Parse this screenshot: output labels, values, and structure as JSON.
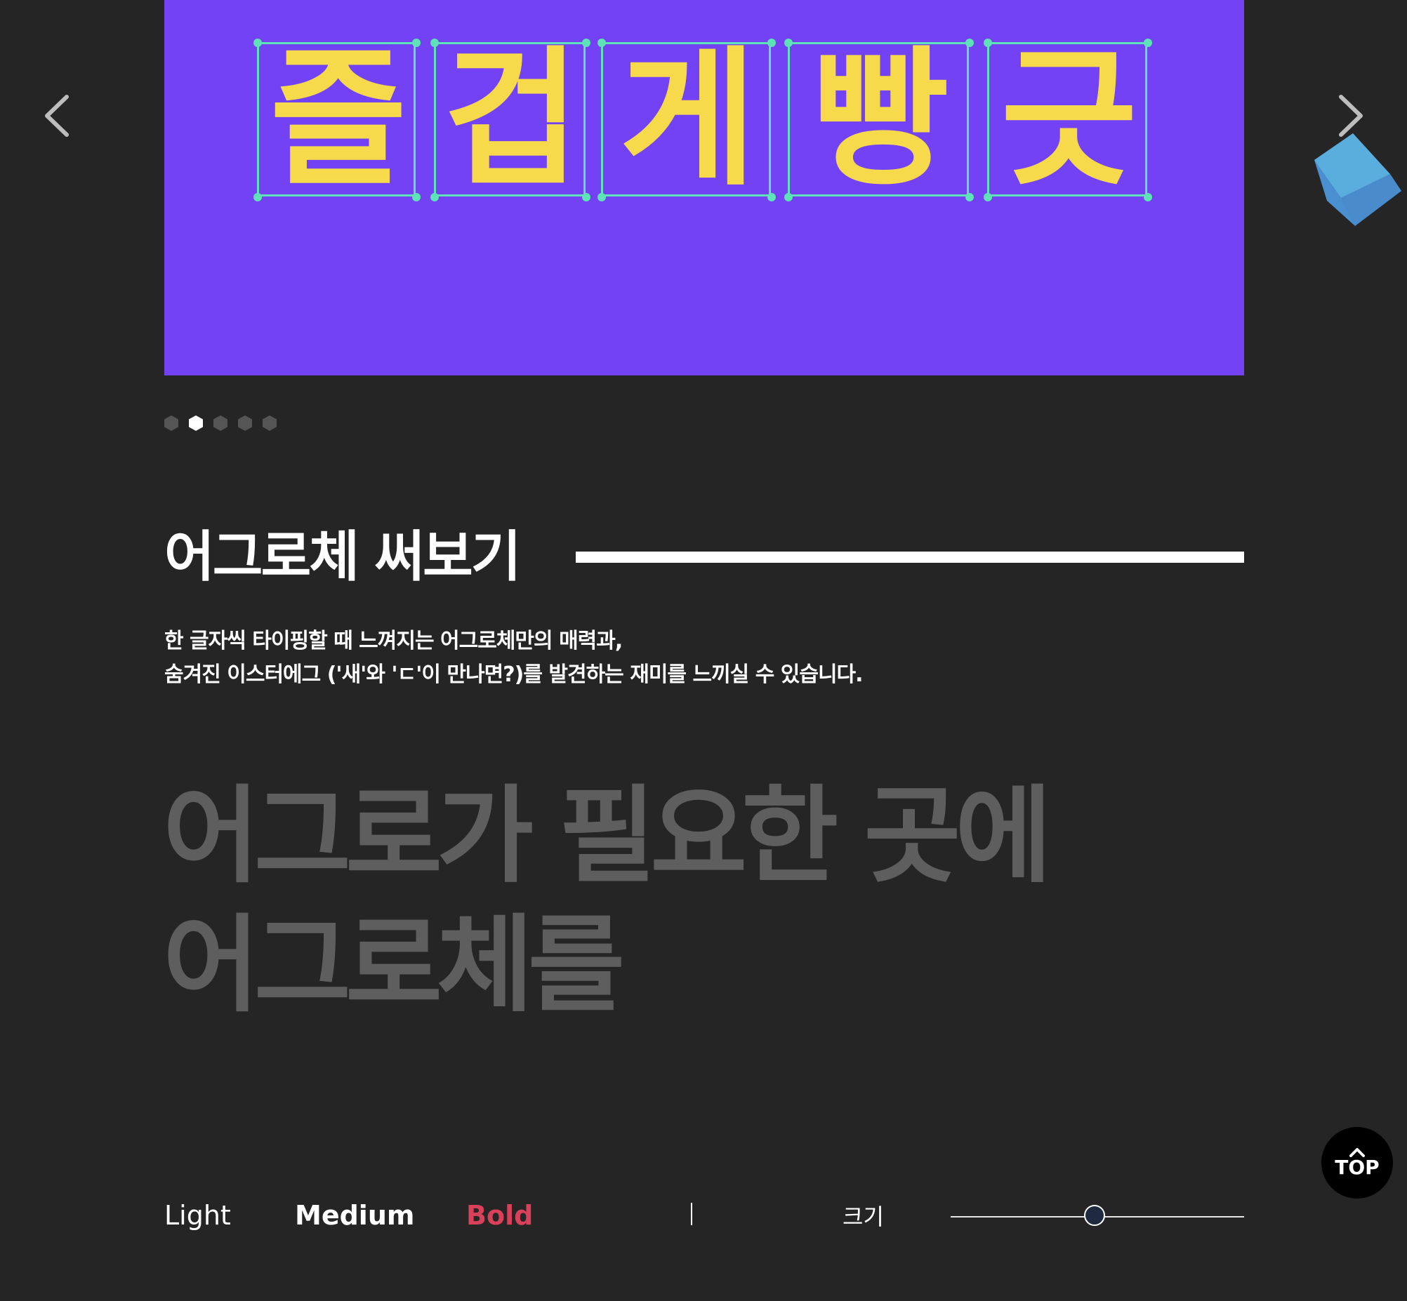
{
  "carousel": {
    "banner_glyphs": [
      "즐",
      "겁",
      "게",
      "빵",
      "긋"
    ],
    "prev_icon": "chevron-left-icon",
    "next_icon": "chevron-right-icon",
    "slide_count": 5,
    "active_slide": 2,
    "banner_color": "#7242f4",
    "glyph_color": "#f7d94c",
    "guide_color": "#5ee2b8"
  },
  "decor": {
    "cube_icon": "cube-icon",
    "cube_color": "#4a90d0"
  },
  "section": {
    "title": "어그로체 써보기",
    "description": [
      "한 글자씩 타이핑할 때 느껴지는 어그로체만의 매력과,",
      "숨겨진 이스터에그 ('새'와 'ㄷ'이 만나면?)를 발견하는 재미를 느끼실 수 있습니다."
    ]
  },
  "sample": {
    "lines": [
      "어그로가 필요한 곳에",
      "어그로체를"
    ],
    "color": "#5e5e5e"
  },
  "controls": {
    "weights": [
      "Light",
      "Medium",
      "Bold"
    ],
    "selected_weight": "Bold",
    "selected_color": "#d9415a",
    "size_label": "크기",
    "size_value_fraction": 0.49
  },
  "top_button": {
    "label": "TOP",
    "icon": "chevron-up-icon"
  }
}
